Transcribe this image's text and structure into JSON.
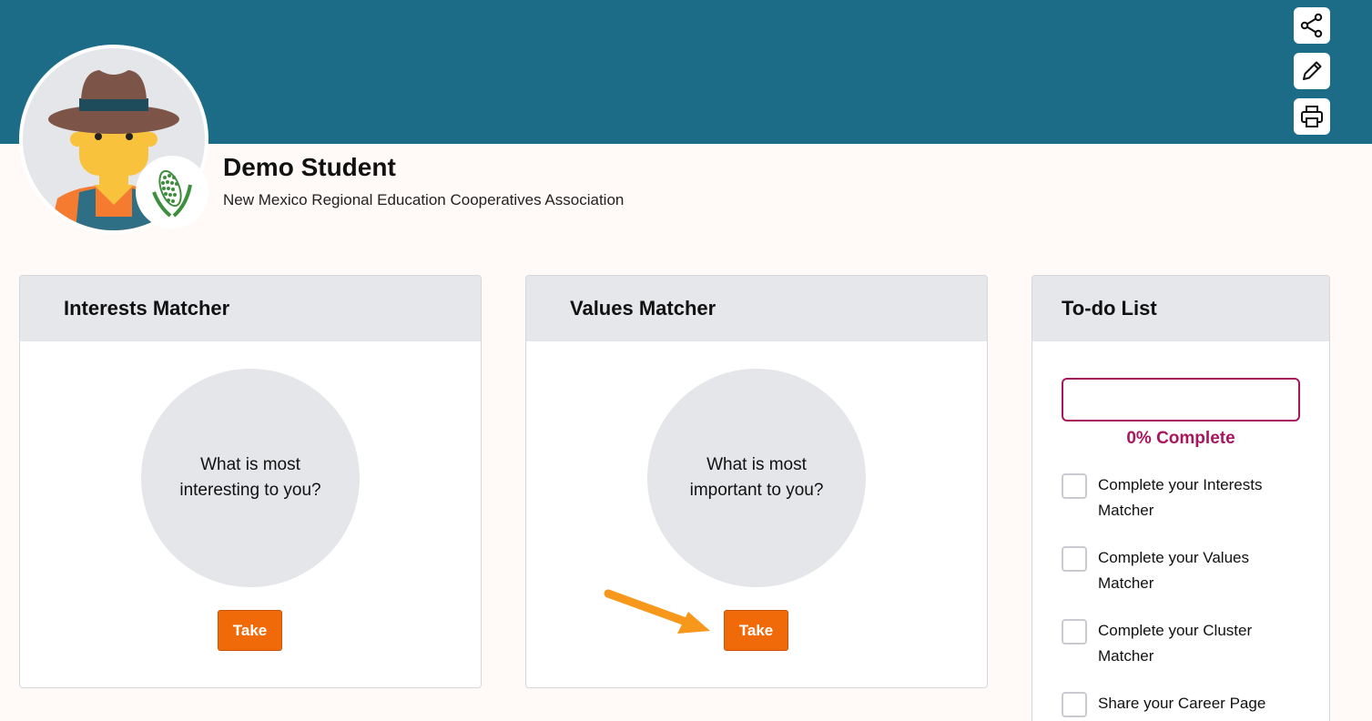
{
  "profile": {
    "name": "Demo Student",
    "organization": "New Mexico Regional Education Cooperatives Association",
    "avatar_icon": "farmer-avatar-icon",
    "cluster_icon": "corn-icon"
  },
  "actions": [
    {
      "name": "share",
      "icon": "share-icon"
    },
    {
      "name": "edit",
      "icon": "pencil-icon"
    },
    {
      "name": "print",
      "icon": "printer-icon"
    }
  ],
  "interests": {
    "title": "Interests Matcher",
    "prompt": "What is most interesting to you?",
    "button": "Take"
  },
  "values": {
    "title": "Values Matcher",
    "prompt": "What is most important to you?",
    "button": "Take"
  },
  "todo": {
    "title": "To-do List",
    "progress_percent": 0,
    "progress_label": "0% Complete",
    "items": [
      {
        "label": "Complete your Interests Matcher",
        "checked": false
      },
      {
        "label": "Complete your Values Matcher",
        "checked": false
      },
      {
        "label": "Complete your Cluster Matcher",
        "checked": false
      },
      {
        "label": "Share your Career Page",
        "checked": false
      }
    ]
  },
  "colors": {
    "banner": "#1c6c88",
    "accent_button": "#f06a0a",
    "progress": "#a8175e",
    "annotation_arrow": "#f7981d"
  }
}
